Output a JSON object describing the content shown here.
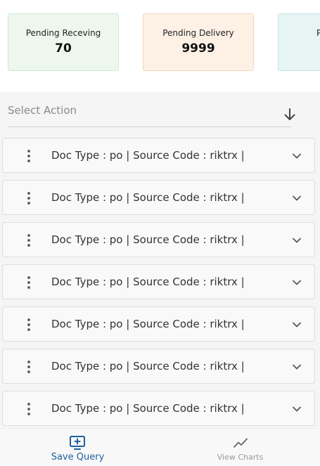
{
  "stats": [
    {
      "label": "Pending Receving",
      "value": "70"
    },
    {
      "label": "Pending Delivery",
      "value": "9999"
    },
    {
      "label": "Pending",
      "value": ""
    }
  ],
  "select_action": {
    "placeholder": "Select Action"
  },
  "rows": [
    {
      "title": "Doc Type : po | Source Code : riktrx |"
    },
    {
      "title": "Doc Type : po | Source Code : riktrx |"
    },
    {
      "title": "Doc Type : po | Source Code : riktrx |"
    },
    {
      "title": "Doc Type : po | Source Code : riktrx |"
    },
    {
      "title": "Doc Type : po | Source Code : riktrx |"
    },
    {
      "title": "Doc Type : po | Source Code : riktrx |"
    },
    {
      "title": "Doc Type : po | Source Code : riktrx |"
    }
  ],
  "bottom_nav": {
    "save_query": "Save Query",
    "view_charts": "View Charts"
  },
  "icons": {
    "save": "desktop-plus-icon",
    "charts": "trend-line-icon",
    "row_menu": "kebab-menu-icon",
    "row_expand": "chevron-down-icon",
    "select_arrow": "arrow-down-icon"
  },
  "colors": {
    "accent": "#1f5fa0",
    "card_green": "#edf7ee",
    "card_orange": "#fdf1e6",
    "card_teal": "#e6f4f4"
  }
}
